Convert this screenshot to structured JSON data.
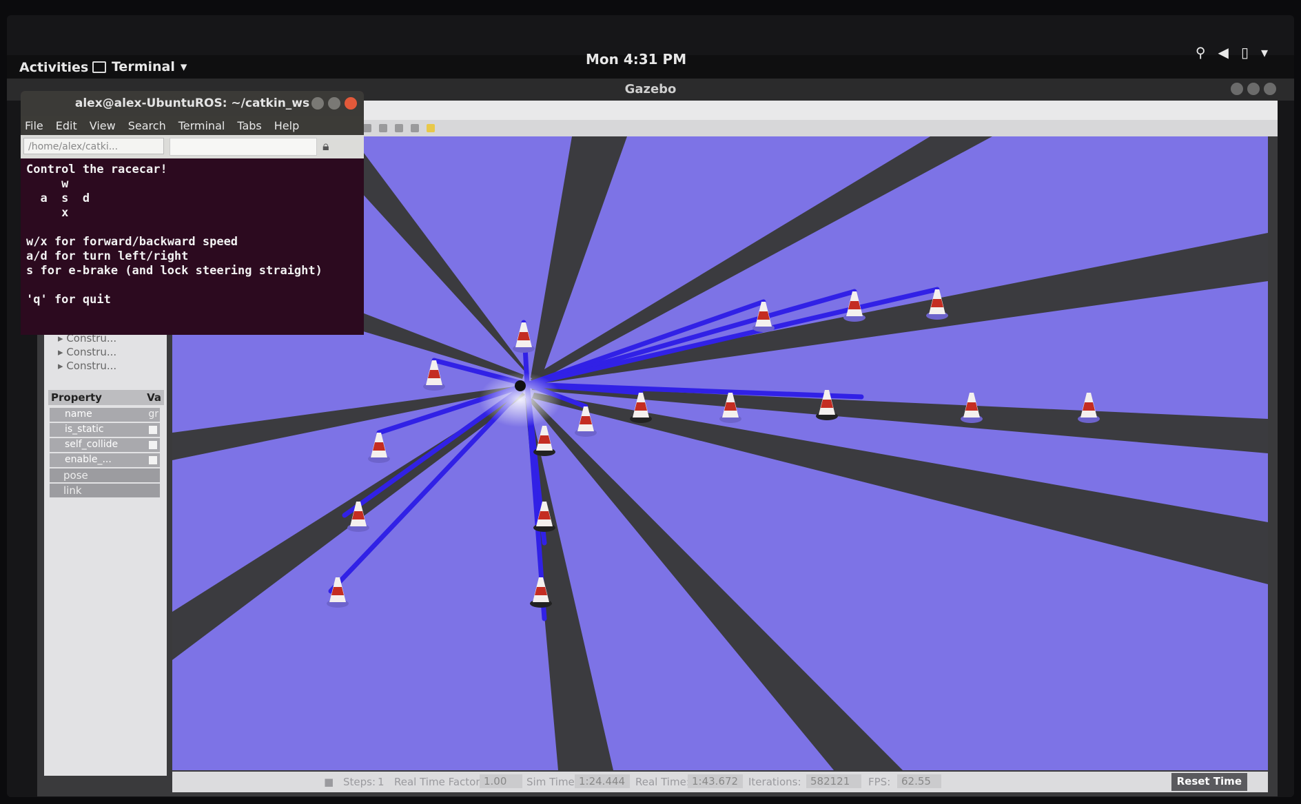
{
  "topbar": {
    "activities": "Activities",
    "app_menu": "Terminal",
    "clock": "Mon 4:31 PM"
  },
  "gazebo": {
    "title": "Gazebo",
    "tree_items": [
      "Constru...",
      "Constru...",
      "Constru..."
    ],
    "property_header": "Property",
    "value_header": "Va",
    "properties": [
      {
        "key": "name",
        "value": "gr"
      },
      {
        "key": "is_static",
        "value": ""
      },
      {
        "key": "self_collide",
        "value": ""
      },
      {
        "key": "enable_...",
        "value": ""
      }
    ],
    "folds": [
      "pose",
      "link"
    ],
    "status": {
      "steps_label": "Steps:",
      "steps_value": "1",
      "rtf_label": "Real Time Factor:",
      "rtf_value": "1.00",
      "sim_time_label": "Sim Time:",
      "sim_time_value": "1:24.444",
      "real_time_label": "Real Time:",
      "real_time_value": "1:43.672",
      "iterations_label": "Iterations:",
      "iterations_value": "582121",
      "fps_label": "FPS:",
      "fps_value": "62.55",
      "reset_label": "Reset Time"
    }
  },
  "terminal": {
    "title": "alex@alex-UbuntuROS: ~/catkin_ws",
    "menu": [
      "File",
      "Edit",
      "View",
      "Search",
      "Terminal",
      "Tabs",
      "Help"
    ],
    "path": "/home/alex/catki...",
    "output": "Control the racecar!\n     w\n  a  s  d\n     x\n\nw/x for forward/backward speed\na/d for turn left/right\ns for e-brake (and lock steering straight)\n\n'q' for quit"
  },
  "colors": {
    "floor": "#7d73e6",
    "laser": "#2a1ee0",
    "shadow": "#3b3b3f",
    "terminal_bg": "#2c0a1f"
  }
}
